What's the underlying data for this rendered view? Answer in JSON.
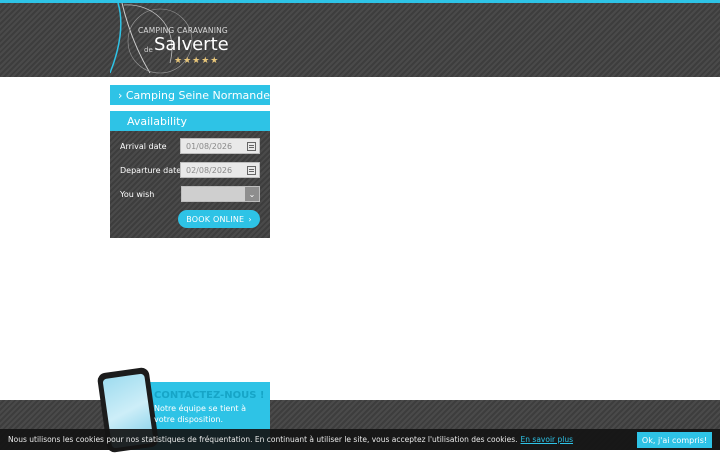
{
  "header": {
    "logo_line1": "CAMPING CARAVANING",
    "logo_de": "de",
    "logo_name": "Salverte",
    "logo_stars": "★★★★★"
  },
  "sidebar": {
    "link_label": "Camping Seine Normande",
    "link_icon": "chevron-right-icon"
  },
  "availability": {
    "title": "Availability",
    "arrival_label": "Arrival date",
    "arrival_value": "01/08/2026",
    "departure_label": "Departure date",
    "departure_value": "02/08/2026",
    "wish_label": "You wish",
    "wish_value": "",
    "book_label": "BOOK ONLINE",
    "book_arrow": "›"
  },
  "contact": {
    "title": "CONTACTEZ-NOUS !",
    "text": "Notre équipe se tient à votre disposition."
  },
  "cookie": {
    "text": "Nous utilisons les cookies pour nos statistiques de fréquentation. En continuant à utiliser le site, vous acceptez l'utilisation des cookies.",
    "link": "En savoir plus",
    "button": "Ok, j'ai compris!"
  },
  "colors": {
    "accent": "#2ec3e6",
    "dark": "#444444"
  }
}
